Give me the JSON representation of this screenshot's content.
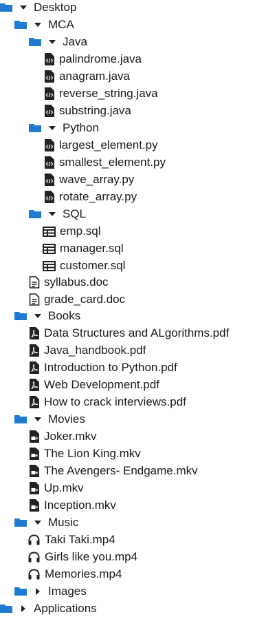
{
  "tree": {
    "desktop": {
      "label": "Desktop",
      "mca": {
        "label": "MCA",
        "java": {
          "label": "Java",
          "files": [
            "palindrome.java",
            "anagram.java",
            "reverse_string.java",
            "substring.java"
          ]
        },
        "python": {
          "label": "Python",
          "files": [
            "largest_element.py",
            "smallest_element.py",
            "wave_array.py",
            "rotate_array.py"
          ]
        },
        "sql": {
          "label": "SQL",
          "files": [
            "emp.sql",
            "manager.sql",
            "customer.sql"
          ]
        },
        "docs": [
          "syllabus.doc",
          "grade_card.doc"
        ]
      },
      "books": {
        "label": "Books",
        "files": [
          "Data Structures and ALgorithms.pdf",
          "Java_handbook.pdf",
          "Introduction to Python.pdf",
          "Web Development.pdf",
          "How to crack interviews.pdf"
        ]
      },
      "movies": {
        "label": "Movies",
        "files": [
          "Joker.mkv",
          "The Lion King.mkv",
          "The Avengers- Endgame.mkv",
          "Up.mkv",
          "Inception.mkv"
        ]
      },
      "music": {
        "label": "Music",
        "files": [
          "Taki Taki.mp4",
          "Girls like you.mp4",
          "Memories.mp4"
        ]
      },
      "images": {
        "label": "Images"
      }
    },
    "applications": {
      "label": "Applications"
    }
  },
  "colors": {
    "folder": "#1f7ad1",
    "icon": "#222222",
    "text": "#1a1a1a"
  }
}
